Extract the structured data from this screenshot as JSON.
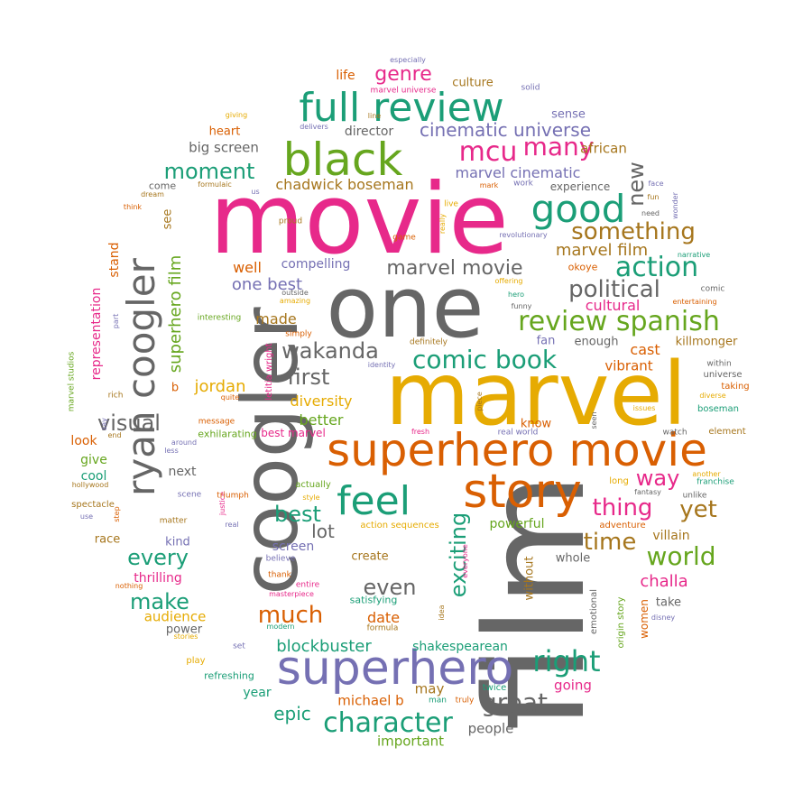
{
  "palette": {
    "teal": "#1b9e77",
    "orange": "#d95f02",
    "purple": "#7570b3",
    "magenta": "#e7298a",
    "green": "#66a61e",
    "gold": "#e6ab02",
    "brown": "#a6761d",
    "gray": "#666666"
  },
  "words": [
    "film",
    "movie",
    "marvel",
    "one",
    "coogler",
    "superhero movie",
    "superhero",
    "ryan coogler",
    "story",
    "black",
    "full review",
    "feel",
    "good",
    "review spanish",
    "character",
    "right",
    "marvel movie",
    "action",
    "political",
    "comic book",
    "great",
    "world",
    "mcu",
    "many",
    "something",
    "wakanda",
    "first",
    "visual",
    "moment",
    "genre",
    "cinematic universe",
    "every",
    "thing",
    "yet",
    "much",
    "new",
    "time",
    "make",
    "exciting",
    "best",
    "epic",
    "way",
    "even",
    "superhero film",
    "blockbuster",
    "marvel film",
    "lot",
    "one best",
    "jordan",
    "made",
    "challa",
    "chadwick boseman",
    "marvel cinematic",
    "african",
    "director",
    "well",
    "compelling",
    "cultural",
    "diversity",
    "better",
    "big screen",
    "date",
    "representation",
    "stand",
    "people",
    "important",
    "audience",
    "heart",
    "thrilling",
    "michael b",
    "shakespearean",
    "going",
    "cast",
    "vibrant",
    "may",
    "year",
    "culture",
    "life",
    "sense",
    "power",
    "look",
    "give",
    "cool",
    "next",
    "killmonger",
    "without",
    "villain",
    "fan",
    "screen",
    "kind",
    "women",
    "take",
    "see",
    "experience",
    "okoye",
    "race",
    "powerful",
    "enough",
    "create",
    "whole",
    "know",
    "letitia wright",
    "emotional",
    "origin story",
    "refreshing",
    "b",
    "best marvel",
    "exhilarating",
    "marvel studios",
    "spectacle",
    "hollywood",
    "adventure",
    "satisfying",
    "action sequences",
    "universe",
    "within",
    "boseman",
    "element",
    "play",
    "twice",
    "real world",
    "beautiful",
    "set",
    "formula",
    "stories",
    "modern",
    "nothing",
    "masterpiece",
    "entire",
    "thank",
    "believe",
    "justice",
    "step",
    "matter",
    "use",
    "scene",
    "triumph",
    "real",
    "style",
    "actually",
    "interesting",
    "simply",
    "amazing",
    "outside",
    "part",
    "rich",
    "say",
    "end",
    "around",
    "less",
    "message",
    "quite",
    "fresh",
    "piece",
    "identity",
    "definitely",
    "funny",
    "hero",
    "offering",
    "seen",
    "issues",
    "watch",
    "diverse",
    "taking",
    "long",
    "fantasy",
    "unlike",
    "another",
    "franchise",
    "disney",
    "entertaining",
    "narrative",
    "comic",
    "live",
    "really",
    "game",
    "revolutionary",
    "proud",
    "mark",
    "work",
    "formulaic",
    "us",
    "come",
    "dream",
    "think",
    "giving",
    "delivers",
    "line",
    "need",
    "fun",
    "face",
    "wonder",
    "solid",
    "especially",
    "marvel universe",
    "idea",
    "everyone",
    "truly",
    "man"
  ]
}
